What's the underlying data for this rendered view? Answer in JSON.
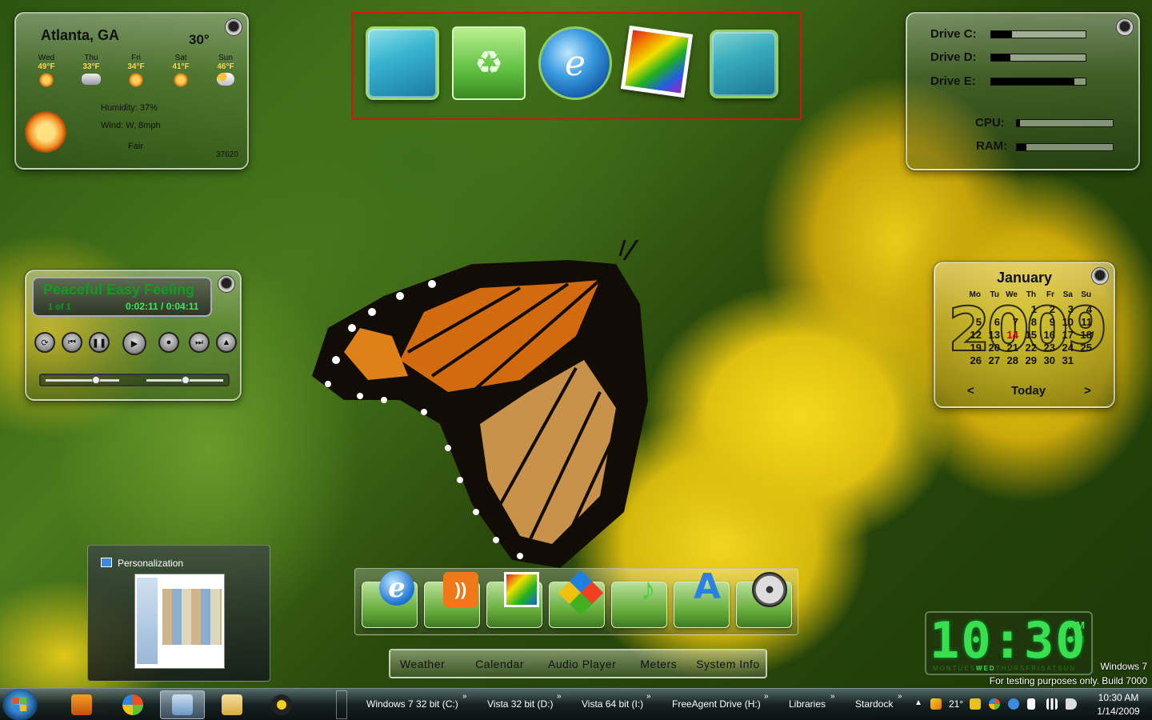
{
  "weather": {
    "city": "Atlanta, GA",
    "current_temp": "30°",
    "days": [
      {
        "name": "Wed",
        "temp": "49°F",
        "icon": "sun-icon"
      },
      {
        "name": "Thu",
        "temp": "33°F",
        "icon": "snow-icon"
      },
      {
        "name": "Fri",
        "temp": "34°F",
        "icon": "sun-icon"
      },
      {
        "name": "Sat",
        "temp": "41°F",
        "icon": "sun-icon"
      },
      {
        "name": "Sun",
        "temp": "46°F",
        "icon": "partly-cloudy-icon"
      }
    ],
    "humidity": "Humidity: 37%",
    "wind": "Wind: W, 8mph",
    "condition": "Fair",
    "zip": "37620"
  },
  "top_dock": {
    "icons": [
      "computer-icon",
      "recycle-bin-icon",
      "internet-explorer-icon",
      "photo-gallery-icon",
      "network-icon"
    ]
  },
  "meters": {
    "drives": [
      {
        "label": "Drive C:",
        "percent": 0.22
      },
      {
        "label": "Drive D:",
        "percent": 0.2
      },
      {
        "label": "Drive E:",
        "percent": 0.88
      }
    ],
    "cpu": {
      "label": "CPU:",
      "percent": 0.03
    },
    "ram": {
      "label": "RAM:",
      "percent": 0.1
    }
  },
  "player": {
    "song": "Peaceful Easy Feeling",
    "track": "1 of 1",
    "time": "0:02:11 / 0:04:11"
  },
  "calendar": {
    "month": "January",
    "year": "2009",
    "weekdays": [
      "Mo",
      "Tu",
      "We",
      "Th",
      "Fr",
      "Sa",
      "Su"
    ],
    "weeks": [
      [
        "",
        "",
        "",
        "1",
        "2",
        "3",
        "4"
      ],
      [
        "5",
        "6",
        "7",
        "8",
        "9",
        "10",
        "11"
      ],
      [
        "12",
        "13",
        "14",
        "15",
        "16",
        "17",
        "18"
      ],
      [
        "19",
        "20",
        "21",
        "22",
        "23",
        "24",
        "25"
      ],
      [
        "26",
        "27",
        "28",
        "29",
        "30",
        "31",
        ""
      ]
    ],
    "today": "14",
    "prev": "<",
    "today_label": "Today",
    "next": ">"
  },
  "thumbnail": {
    "title": "Personalization"
  },
  "bottom_dock": {
    "icons": [
      "internet-explorer-icon",
      "rss-feed-icon",
      "photo-gallery-icon",
      "windows-logo-icon",
      "music-icon",
      "font-icon",
      "film-reel-icon"
    ]
  },
  "gadget_tabs": [
    "Weather",
    "Calendar",
    "Audio Player",
    "Meters",
    "System Info"
  ],
  "clock": {
    "time": "10:30",
    "am": "AM",
    "pm": "PM",
    "weekdays": [
      "MON",
      "TUES",
      "WED",
      "THURS",
      "FRI",
      "SAT",
      "SUN"
    ],
    "active_day": "WED"
  },
  "watermark": {
    "line1": "Windows 7",
    "line2": "For testing purposes only. Build 7000"
  },
  "taskbar": {
    "toolbars": [
      "Windows 7 32 bit (C:)",
      "Vista 32 bit (D:)",
      "Vista 64 bit (I:)",
      "FreeAgent Drive (H:)",
      "Libraries",
      "Stardock"
    ],
    "tray_temp": "21°",
    "time": "10:30 AM",
    "date": "1/14/2009"
  }
}
